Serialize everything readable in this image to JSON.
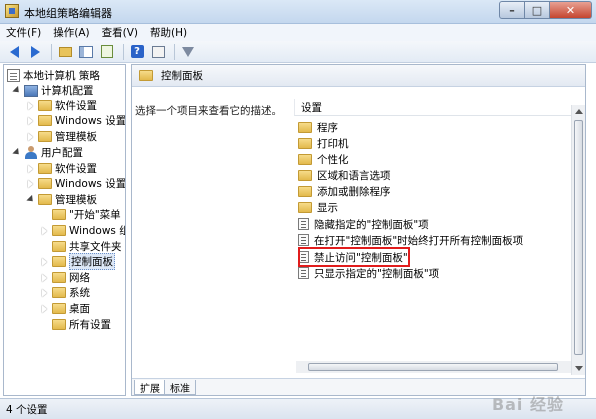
{
  "window": {
    "title": "本地组策略编辑器"
  },
  "menu": [
    "文件(F)",
    "操作(A)",
    "查看(V)",
    "帮助(H)"
  ],
  "toolbar": {
    "icons": [
      "back-arrow-icon",
      "forward-arrow-icon",
      "up-folder-icon",
      "show-hide-tree-icon",
      "export-list-icon",
      "help-icon",
      "properties-icon",
      "filter-icon"
    ]
  },
  "tree": {
    "root": "本地计算机 策略",
    "computer_config": "计算机配置",
    "cc_software": "软件设置",
    "cc_windows": "Windows 设置",
    "cc_admin": "管理模板",
    "user_config": "用户配置",
    "uc_software": "软件设置",
    "uc_windows": "Windows 设置",
    "uc_admin": "管理模板",
    "start_menu": "\"开始\"菜单",
    "windows_components": "Windows 组",
    "shared_folders": "共享文件夹",
    "control_panel": "控制面板",
    "network": "网络",
    "system": "系统",
    "desktop": "桌面",
    "all_settings": "所有设置"
  },
  "details": {
    "header_title": "控制面板",
    "description": "选择一个项目来查看它的描述。",
    "column_header": "设置",
    "items": [
      {
        "type": "folder",
        "label": "程序"
      },
      {
        "type": "folder",
        "label": "打印机"
      },
      {
        "type": "folder",
        "label": "个性化"
      },
      {
        "type": "folder",
        "label": "区域和语言选项"
      },
      {
        "type": "folder",
        "label": "添加或删除程序"
      },
      {
        "type": "folder",
        "label": "显示"
      },
      {
        "type": "setting",
        "label": "隐藏指定的\"控制面板\"项"
      },
      {
        "type": "setting",
        "label": "在打开\"控制面板\"时始终打开所有控制面板项"
      },
      {
        "type": "setting",
        "label": "禁止访问\"控制面板\""
      },
      {
        "type": "setting",
        "label": "只显示指定的\"控制面板\"项"
      }
    ],
    "highlight_color": "#e11c1c"
  },
  "tabs": [
    "扩展",
    "标准"
  ],
  "status": {
    "text": "4 个设置"
  },
  "watermark": "Bai 经验"
}
